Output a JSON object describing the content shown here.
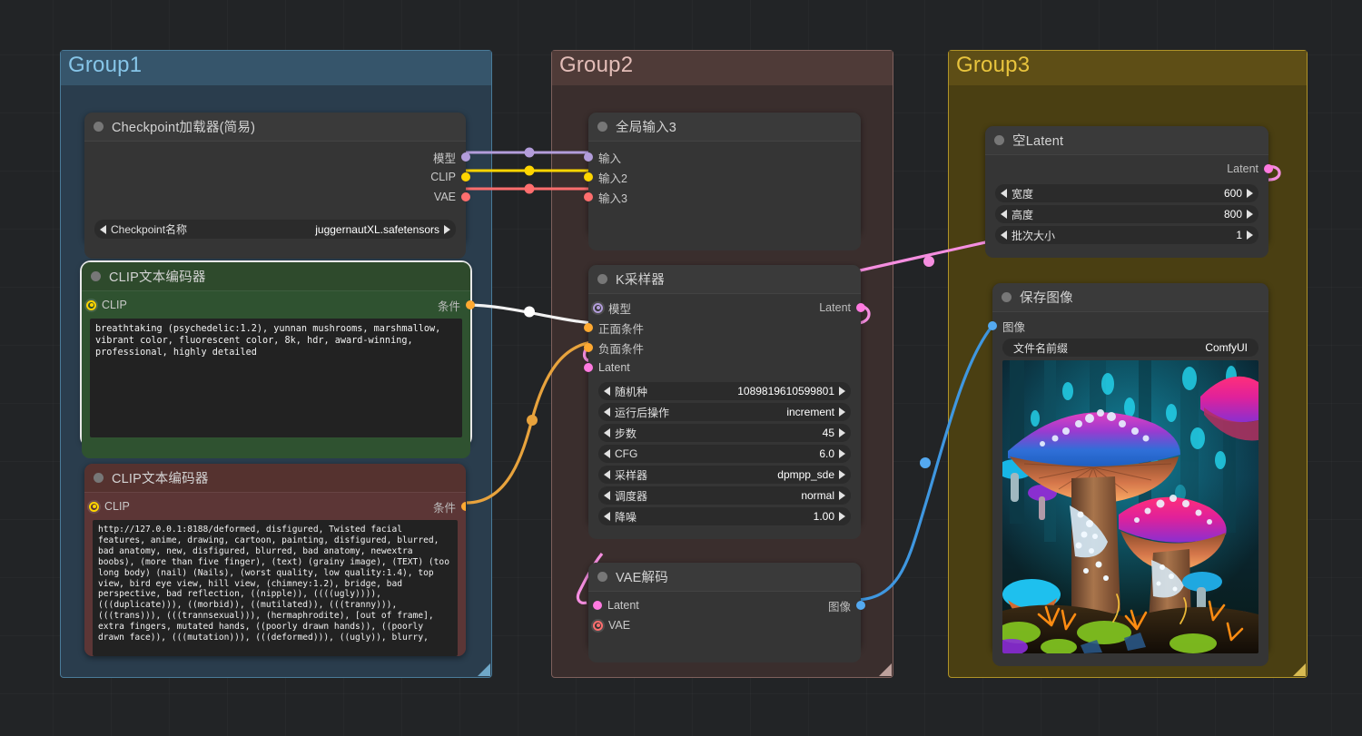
{
  "canvas": {
    "background": "#222426",
    "grid_color": "#2b2d30"
  },
  "groups": [
    {
      "id": "group1",
      "title": "Group1",
      "color": "#3f6e8c",
      "body": "#2a3d4d",
      "title_color": "#86c5e8"
    },
    {
      "id": "group2",
      "title": "Group2",
      "color": "#8c6a66",
      "body": "#3a2e2d",
      "title_color": "#e3bdb8"
    },
    {
      "id": "group3",
      "title": "Group3",
      "color": "#b79a2a",
      "body": "#4a3f12",
      "title_color": "#e8c43d"
    }
  ],
  "nodes": {
    "checkpoint_loader": {
      "title": "Checkpoint加载器(简易)",
      "outputs": [
        {
          "label": "模型",
          "color": "#b39ddb"
        },
        {
          "label": "CLIP",
          "color": "#ffd500"
        },
        {
          "label": "VAE",
          "color": "#ff6e6e"
        }
      ],
      "widgets": [
        {
          "label": "Checkpoint名称",
          "value": "juggernautXL.safetensors"
        }
      ]
    },
    "clip_positive": {
      "title": "CLIP文本编码器",
      "accent": "#2f5230",
      "header": "#2e4a2c",
      "input": {
        "label": "CLIP",
        "color": "#ffd500"
      },
      "output": {
        "label": "条件",
        "color": "#ffa931"
      },
      "text": "breathtaking (psychedelic:1.2), yunnan mushrooms, marshmallow, vibrant color, fluorescent color, 8k, hdr, award-winning, professional, highly detailed"
    },
    "clip_negative": {
      "title": "CLIP文本编码器",
      "accent": "#5c3636",
      "header": "#55322f",
      "input": {
        "label": "CLIP",
        "color": "#ffd500"
      },
      "output": {
        "label": "条件",
        "color": "#ffa931"
      },
      "text": "http://127.0.0.1:8188/deformed, disfigured, Twisted facial features, anime, drawing, cartoon, painting, disfigured, blurred, bad anatomy, new, disfigured, blurred, bad anatomy, newextra boobs), (more than five finger), (text) (grainy image), (TEXT) (too long body) (nail) (Nails), (worst quality, low quality:1.4), top view, bird eye view, hill view, (chimney:1.2), bridge, bad perspective, bad reflection, ((nipple)), ((((ugly)))), (((duplicate))), ((morbid)), ((mutilated)), (((tranny))), (((trans))), (((trannsexual))), (hermaphrodite), [out of frame], extra fingers, mutated hands, ((poorly drawn hands)), ((poorly drawn face)), (((mutation))), (((deformed))), ((ugly)), blurry,"
    },
    "global_input": {
      "title": "全局输入3",
      "inputs": [
        {
          "label": "输入",
          "color": "#b39ddb"
        },
        {
          "label": "输入2",
          "color": "#ffd500"
        },
        {
          "label": "输入3",
          "color": "#ff6e6e"
        }
      ]
    },
    "ksampler": {
      "title": "K采样器",
      "inputs": [
        {
          "label": "模型",
          "color": "#b39ddb",
          "ring": true
        },
        {
          "label": "正面条件",
          "color": "#ffa931"
        },
        {
          "label": "负面条件",
          "color": "#ffa931"
        },
        {
          "label": "Latent",
          "color": "#ff7ae0"
        }
      ],
      "outputs": [
        {
          "label": "Latent",
          "color": "#ff7ae0"
        }
      ],
      "widgets": [
        {
          "label": "随机种",
          "value": "1089819610599801"
        },
        {
          "label": "运行后操作",
          "value": "increment"
        },
        {
          "label": "步数",
          "value": "45"
        },
        {
          "label": "CFG",
          "value": "6.0"
        },
        {
          "label": "采样器",
          "value": "dpmpp_sde"
        },
        {
          "label": "调度器",
          "value": "normal"
        },
        {
          "label": "降噪",
          "value": "1.00"
        }
      ]
    },
    "vae_decode": {
      "title": "VAE解码",
      "inputs": [
        {
          "label": "Latent",
          "color": "#ff7ae0"
        },
        {
          "label": "VAE",
          "color": "#ff6e6e",
          "ring": true
        }
      ],
      "outputs": [
        {
          "label": "图像",
          "color": "#54a9f0"
        }
      ]
    },
    "empty_latent": {
      "title": "空Latent",
      "outputs": [
        {
          "label": "Latent",
          "color": "#ff7ae0"
        }
      ],
      "widgets": [
        {
          "label": "宽度",
          "value": "600"
        },
        {
          "label": "高度",
          "value": "800"
        },
        {
          "label": "批次大小",
          "value": "1"
        }
      ]
    },
    "save_image": {
      "title": "保存图像",
      "inputs": [
        {
          "label": "图像",
          "color": "#54a9f0"
        }
      ],
      "widgets": [
        {
          "label": "文件名前缀",
          "value": "ComfyUI"
        }
      ],
      "preview_alt": "psychedelic glowing mushrooms in a forest"
    }
  },
  "links": [
    {
      "from": "模型",
      "to": "输入",
      "color": "#b39ddb"
    },
    {
      "from": "CLIP",
      "to": "输入2",
      "color": "#ffd500"
    },
    {
      "from": "VAE",
      "to": "输入3",
      "color": "#ff6e6e"
    },
    {
      "from": "条件(正)",
      "to": "正面条件",
      "color": "#f0f0f0"
    },
    {
      "from": "条件(负)",
      "to": "负面条件",
      "color": "#e8a33d"
    },
    {
      "from": "Latent",
      "to": "Latent",
      "color": "#f58ee0"
    },
    {
      "from": "图像",
      "to": "图像",
      "color": "#3f97e0"
    }
  ]
}
